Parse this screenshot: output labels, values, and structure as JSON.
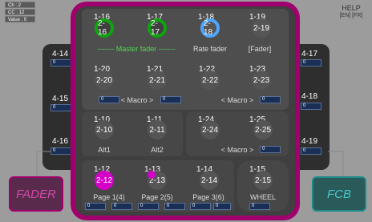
{
  "status": {
    "ch": "Ch : 2",
    "cc": "CC : 12",
    "value": "Value : 0"
  },
  "help": {
    "title": "HELP",
    "langs": "[EN] [FR]"
  },
  "left_wing": [
    {
      "num": "4-14",
      "val": "0"
    },
    {
      "num": "4-15",
      "val": "0"
    },
    {
      "num": "4-16",
      "val": "0"
    }
  ],
  "right_wing": [
    {
      "num": "4-17",
      "val": "0"
    },
    {
      "num": "4-18",
      "val": "0"
    },
    {
      "num": "4-19",
      "val": "0"
    }
  ],
  "top": {
    "knobs": [
      {
        "num": "1-16",
        "knob": "2-16"
      },
      {
        "num": "1-17",
        "knob": "2-17"
      },
      {
        "num": "1-18",
        "knob": "2-18"
      },
      {
        "num": "1-19",
        "knob": "2-19"
      }
    ],
    "master_label": "------- Master fader -------",
    "rate_label": "Rate fader",
    "fader_label": "[Fader]"
  },
  "macros": [
    {
      "num": "1-20",
      "knob": "2-20"
    },
    {
      "num": "1-21",
      "knob": "2-21"
    },
    {
      "num": "1-22",
      "knob": "2-22"
    },
    {
      "num": "1-23",
      "knob": "2-23"
    }
  ],
  "macro_left": {
    "val": "0",
    "label": "< Macro >",
    "val2": "0"
  },
  "macro_right": {
    "label": "< Macro >",
    "val": "0"
  },
  "alt": [
    {
      "num": "1-10",
      "knob": "2-10",
      "label": "Alt1"
    },
    {
      "num": "1-11",
      "knob": "2-11",
      "label": "Alt2"
    }
  ],
  "macro3": [
    {
      "num": "1-24",
      "knob": "2-24"
    },
    {
      "num": "1-25",
      "knob": "2-25"
    }
  ],
  "macro3_ctrl": {
    "label": "< Macro >",
    "val": "0"
  },
  "pages": [
    {
      "num": "1-12",
      "knob": "2-12",
      "label": "Page 1(4)",
      "v1": "0",
      "v2": "0"
    },
    {
      "num": "1-13",
      "knob": "2-13",
      "label": "Page 2(5)",
      "v1": "0",
      "v2": "0"
    },
    {
      "num": "1-14",
      "knob": "2-14",
      "label": "Page 3(6)",
      "v1": "0",
      "v2": "0"
    }
  ],
  "wheel": {
    "num": "1-15",
    "knob": "2-15",
    "label": "WHEEL",
    "val": "0"
  },
  "corners": {
    "fader": "FADER",
    "fcb": "FCB"
  },
  "colors": {
    "magenta": "#a0006e",
    "green": "#0fa30f",
    "blue": "#4da6ff",
    "pink": "#d400c8"
  }
}
